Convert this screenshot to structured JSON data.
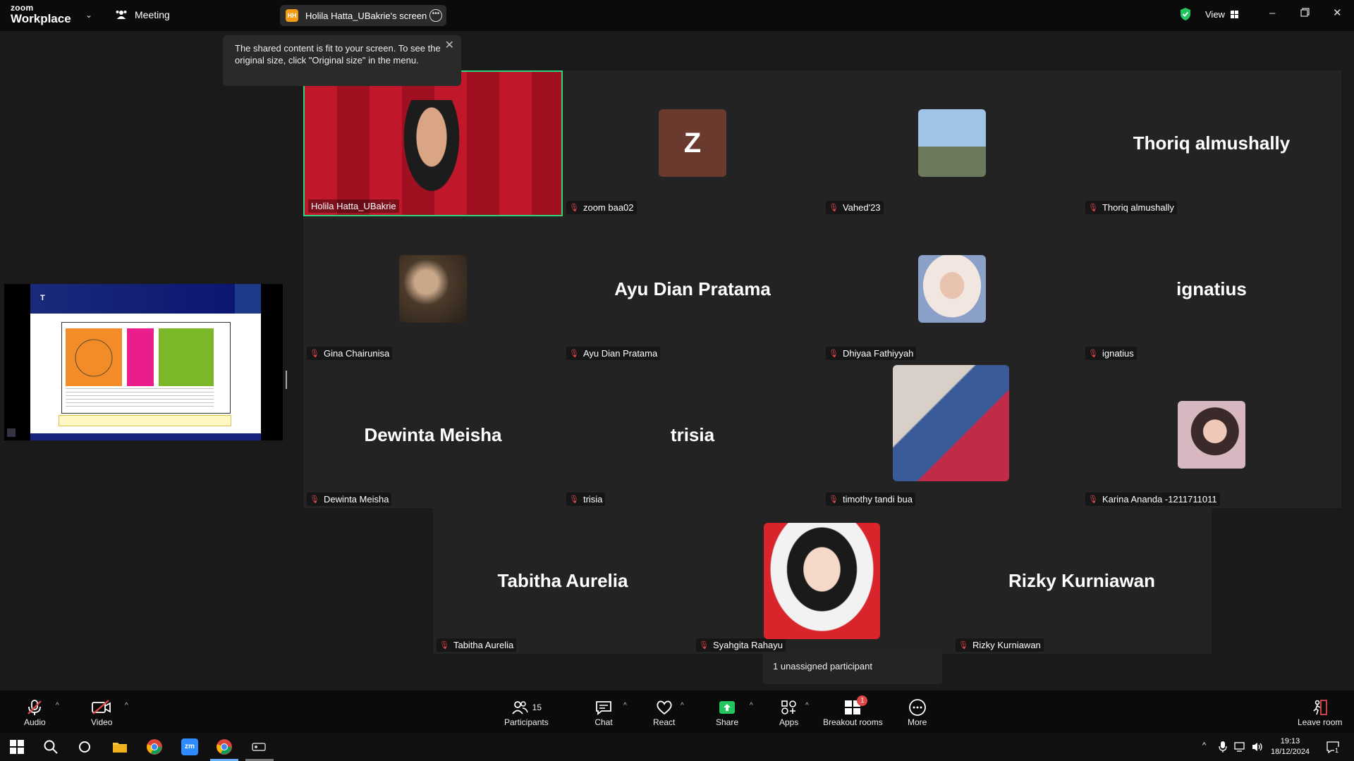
{
  "titlebar": {
    "brand_top": "zoom",
    "brand_bottom": "Workplace",
    "meeting_label": "Meeting",
    "share_initials": "HH",
    "share_title": "Holila Hatta_UBakrie's screen",
    "view_label": "View"
  },
  "tooltip": {
    "text": "The shared content is fit to your screen. To see the original size, click \"Original size\" in the menu."
  },
  "shared_slide": {
    "title_letter": "T"
  },
  "participants": [
    {
      "big_name": "",
      "label": "Holila Hatta_UBakrie",
      "muted": false,
      "video": true
    },
    {
      "big_name": "",
      "initial": "Z",
      "label": "zoom baa02",
      "muted": true
    },
    {
      "big_name": "",
      "label": "Vahed'23",
      "muted": true
    },
    {
      "big_name": "Thoriq almushally",
      "label": "Thoriq almushally",
      "muted": true
    },
    {
      "big_name": "",
      "label": "Gina Chairunisa",
      "muted": true
    },
    {
      "big_name": "Ayu Dian Pratama",
      "label": "Ayu Dian Pratama",
      "muted": true
    },
    {
      "big_name": "",
      "label": "Dhiyaa Fathiyyah",
      "muted": true
    },
    {
      "big_name": "ignatius",
      "label": "ignatius",
      "muted": true
    },
    {
      "big_name": "Dewinta Meisha",
      "label": "Dewinta Meisha",
      "muted": true
    },
    {
      "big_name": "trisia",
      "label": "trisia",
      "muted": true
    },
    {
      "big_name": "",
      "label": "timothy tandi bua",
      "muted": true
    },
    {
      "big_name": "",
      "label": "Karina Ananda -1211711011",
      "muted": true
    },
    {
      "big_name": "Tabitha Aurelia",
      "label": "Tabitha Aurelia",
      "muted": true
    },
    {
      "big_name": "",
      "label": "Syahgita Rahayu",
      "muted": true
    },
    {
      "big_name": "Rizky Kurniawan",
      "label": "Rizky Kurniawan",
      "muted": true
    }
  ],
  "breakout_info": "1 unassigned participant",
  "toolbar": {
    "audio": "Audio",
    "video": "Video",
    "participants": "Participants",
    "participants_count": "15",
    "chat": "Chat",
    "react": "React",
    "share": "Share",
    "apps": "Apps",
    "breakout": "Breakout rooms",
    "breakout_badge": "1",
    "more": "More",
    "leave": "Leave room"
  },
  "taskbar": {
    "time": "19:13",
    "date": "18/12/2024",
    "notifications": "1"
  },
  "colors": {
    "active_speaker": "#2ed47a",
    "muted_mic": "#e04848",
    "share_green": "#22c55e",
    "avatar_z": "#6b3a2e"
  }
}
